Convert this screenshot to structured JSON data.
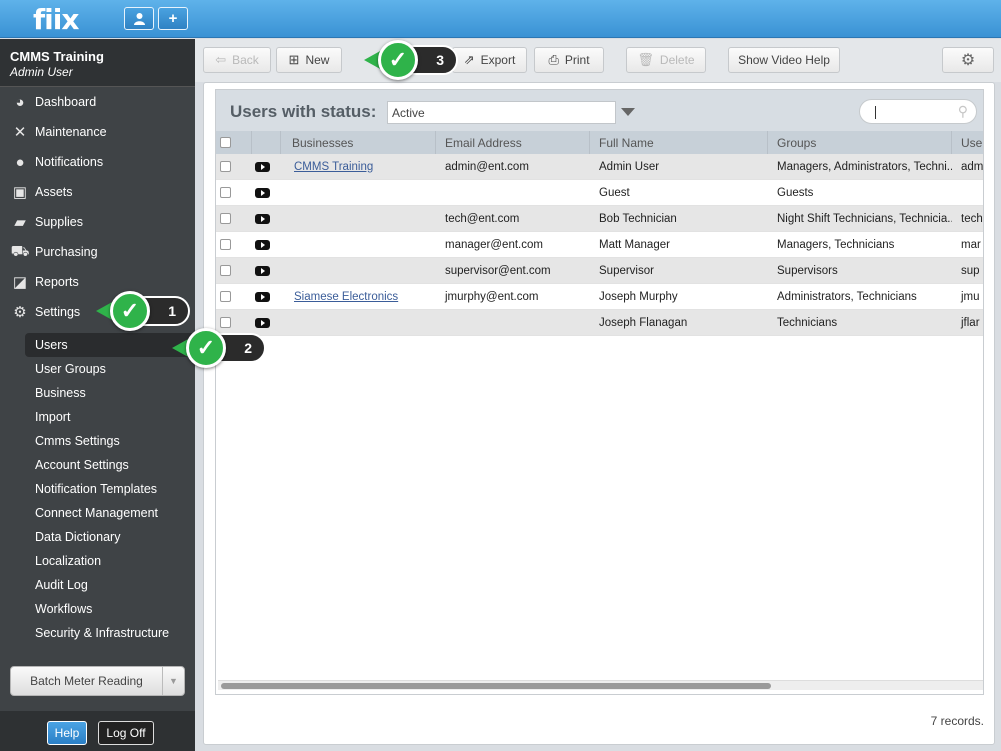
{
  "topbar": {
    "logo": "fiix",
    "user_icon": "user-icon",
    "add_icon": "plus-icon",
    "add_label": "+"
  },
  "sidebar": {
    "org_name": "CMMS Training",
    "user_name": "Admin User",
    "nav": [
      {
        "label": "Dashboard",
        "icon": "dashboard-icon",
        "glyph": "◕"
      },
      {
        "label": "Maintenance",
        "icon": "wrench-icon",
        "glyph": "✕"
      },
      {
        "label": "Notifications",
        "icon": "speech-bubble-icon",
        "glyph": "●"
      },
      {
        "label": "Assets",
        "icon": "box-icon",
        "glyph": "▣"
      },
      {
        "label": "Supplies",
        "icon": "truck-icon",
        "glyph": "▰"
      },
      {
        "label": "Purchasing",
        "icon": "cart-icon",
        "glyph": "⛟"
      },
      {
        "label": "Reports",
        "icon": "chart-icon",
        "glyph": "◪"
      },
      {
        "label": "Settings",
        "icon": "gear-icon",
        "glyph": "⚙"
      }
    ],
    "sub_nav": [
      "Users",
      "User Groups",
      "Business",
      "Import",
      "Cmms Settings",
      "Account Settings",
      "Notification Templates",
      "Connect Management",
      "Data Dictionary",
      "Localization",
      "Audit Log",
      "Workflows",
      "Security & Infrastructure"
    ],
    "batch_button": "Batch Meter Reading",
    "help_button": "Help",
    "logoff_button": "Log Off"
  },
  "toolbar": {
    "back": "Back",
    "new": "New",
    "export": "Export",
    "print": "Print",
    "delete": "Delete",
    "video_help": "Show Video Help"
  },
  "main": {
    "status_title": "Users with status:",
    "status_value": "Active",
    "search_value": "",
    "columns": [
      "Businesses",
      "Email Address",
      "Full Name",
      "Groups",
      "Use"
    ],
    "rows": [
      {
        "business": "CMMS Training",
        "email": "admin@ent.com",
        "name": "Admin User",
        "groups": "Managers, Administrators, Techni...",
        "user": "adm"
      },
      {
        "business": "",
        "email": "",
        "name": "Guest",
        "groups": "Guests",
        "user": ""
      },
      {
        "business": "",
        "email": "tech@ent.com",
        "name": "Bob Technician",
        "groups": "Night Shift Technicians, Technicia...",
        "user": "tech"
      },
      {
        "business": "",
        "email": "manager@ent.com",
        "name": "Matt Manager",
        "groups": "Managers, Technicians",
        "user": "mar"
      },
      {
        "business": "",
        "email": "supervisor@ent.com",
        "name": "Supervisor",
        "groups": "Supervisors",
        "user": "sup"
      },
      {
        "business": "Siamese Electronics",
        "email": "jmurphy@ent.com",
        "name": "Joseph Murphy",
        "groups": "Administrators, Technicians",
        "user": "jmu"
      },
      {
        "business": "",
        "email": "",
        "name": "Joseph Flanagan",
        "groups": "Technicians",
        "user": "jflar"
      }
    ],
    "records": "7 records."
  },
  "callouts": [
    "1",
    "2",
    "3"
  ],
  "colors": {
    "topbar": "#3a92d4",
    "sidebar": "#3f4346",
    "callout": "#2fb34a"
  }
}
